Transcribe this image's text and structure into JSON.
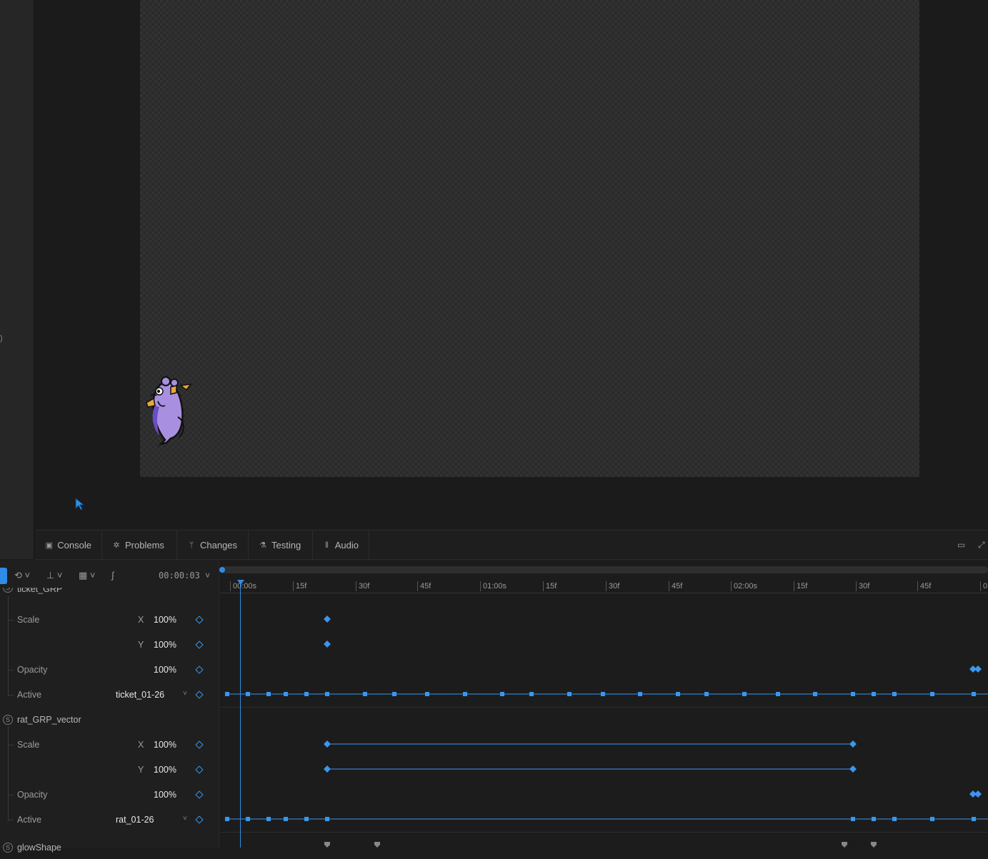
{
  "viewport": {
    "left_mark": ")"
  },
  "bottom_tabs": [
    {
      "label": "Console",
      "icon": "console-icon"
    },
    {
      "label": "Problems",
      "icon": "bug-icon"
    },
    {
      "label": "Changes",
      "icon": "branch-icon"
    },
    {
      "label": "Testing",
      "icon": "flask-icon"
    },
    {
      "label": "Audio",
      "icon": "waveform-icon"
    }
  ],
  "timeline": {
    "timecode": "00:00:03",
    "ruler_ticks": [
      "00:00s",
      "15f",
      "30f",
      "45f",
      "01:00s",
      "15f",
      "30f",
      "45f",
      "02:00s",
      "15f",
      "30f",
      "45f",
      "0"
    ],
    "groups": [
      {
        "name": "ticket_GRP",
        "properties": [
          {
            "label": "Scale",
            "axis": "X",
            "value": "100%"
          },
          {
            "label": "",
            "axis": "Y",
            "value": "100%"
          },
          {
            "label": "Opacity",
            "axis": "",
            "value": "100%"
          },
          {
            "label": "Active",
            "axis": "",
            "value": "ticket_01-26",
            "dropdown": true
          }
        ]
      },
      {
        "name": "rat_GRP_vector",
        "properties": [
          {
            "label": "Scale",
            "axis": "X",
            "value": "100%"
          },
          {
            "label": "",
            "axis": "Y",
            "value": "100%"
          },
          {
            "label": "Opacity",
            "axis": "",
            "value": "100%"
          },
          {
            "label": "Active",
            "axis": "",
            "value": "rat_01-26",
            "dropdown": true
          }
        ]
      },
      {
        "name": "glowShape",
        "properties": []
      }
    ]
  },
  "colors": {
    "accent": "#2e8de6",
    "keyframe": "#3a96ee",
    "background": "#1c1c1c"
  }
}
